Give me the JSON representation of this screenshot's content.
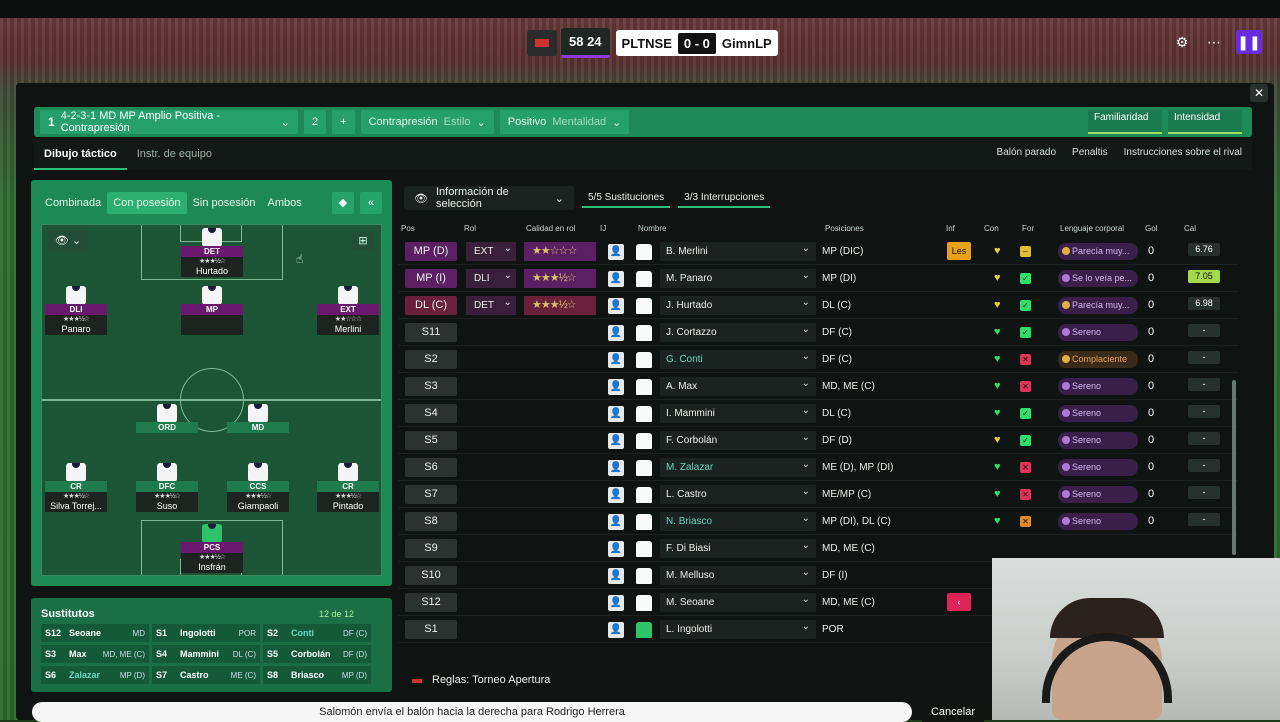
{
  "score": {
    "time": "58 24",
    "home": "PLTNSE",
    "result": "0 - 0",
    "away": "GimnLP"
  },
  "tactic": {
    "num": "1",
    "name": "4-2-3-1 MD MP Amplio Positiva - Contrapresión",
    "slot": "2",
    "add": "+",
    "style_value": "Contrapresión",
    "style_label": "Estilo",
    "mentality_value": "Positivo",
    "mentality_label": "Mentalidad",
    "familiarity": "Familiaridad",
    "intensity": "Intensidad"
  },
  "tabs": [
    "Dibujo táctico",
    "Instr. de equipo"
  ],
  "actions": [
    "Balón parado",
    "Penaltis",
    "Instrucciones sobre el rival"
  ],
  "pitch_tabs": [
    "Combinada",
    "Con posesión",
    "Sin posesión",
    "Ambos"
  ],
  "pitch_players": [
    {
      "role": "DET",
      "stars": "★★★½☆",
      "name": "Hurtado",
      "color": "purple"
    },
    {
      "role": "DLI",
      "stars": "★★★½☆",
      "name": "Panaro",
      "color": "purple"
    },
    {
      "role": "MP",
      "stars": "",
      "name": "",
      "color": "purple"
    },
    {
      "role": "EXT",
      "stars": "★★☆☆☆",
      "name": "Merlini",
      "color": "purple"
    },
    {
      "role": "ORD",
      "stars": "",
      "name": "",
      "color": "green"
    },
    {
      "role": "MD",
      "stars": "",
      "name": "",
      "color": "green"
    },
    {
      "role": "CR",
      "stars": "★★★½☆",
      "name": "Silva Torrej...",
      "color": "green"
    },
    {
      "role": "DFC",
      "stars": "★★★½☆",
      "name": "Suso",
      "color": "green"
    },
    {
      "role": "CCS",
      "stars": "★★★½☆",
      "name": "Giampaoli",
      "color": "green"
    },
    {
      "role": "CR",
      "stars": "★★★½☆",
      "name": "Pintado",
      "color": "green"
    },
    {
      "role": "PCS",
      "stars": "★★★½☆",
      "name": "Insfrán",
      "color": "green"
    }
  ],
  "subs": {
    "title": "Sustitutos",
    "count": "12 de 12",
    "items": [
      {
        "n": "S12",
        "name": "Seoane",
        "pos": "MD",
        "teal": false
      },
      {
        "n": "S1",
        "name": "Ingolotti",
        "pos": "POR",
        "teal": false
      },
      {
        "n": "S2",
        "name": "Conti",
        "pos": "DF (C)",
        "teal": true
      },
      {
        "n": "S3",
        "name": "Max",
        "pos": "MD, ME (C)",
        "teal": false
      },
      {
        "n": "S4",
        "name": "Mammini",
        "pos": "DL (C)",
        "teal": false
      },
      {
        "n": "S5",
        "name": "Corbolán",
        "pos": "DF (D)",
        "teal": false
      },
      {
        "n": "S6",
        "name": "Zalazar",
        "pos": "MP (D)",
        "teal": true
      },
      {
        "n": "S7",
        "name": "Castro",
        "pos": "ME (C)",
        "teal": false
      },
      {
        "n": "S8",
        "name": "Briasco",
        "pos": "MP (D)",
        "teal": false
      }
    ]
  },
  "table": {
    "info_btn": "Información de selección",
    "subs_count": "5/5 Sustituciones",
    "interruptions": "3/3 Interrupciones",
    "headers": [
      "Pos",
      "Rol",
      "Calidad en rol",
      "IJ",
      "Nombre",
      "Posiciones",
      "Inf",
      "Con",
      "For",
      "Lenguaje corporal",
      "Gol",
      "Cal"
    ],
    "rows": [
      {
        "pos": "MP (D)",
        "pc": "purple",
        "rol": "EXT",
        "stars": "★★☆☆☆",
        "sc": "purple",
        "name": "B. Merlini",
        "teal": false,
        "posi": "MP (DIC)",
        "inf": "Les",
        "ic": "",
        "con": "♥",
        "cc": "y",
        "for": "–",
        "fc": "y",
        "lang": "Parecía muy...",
        "lc": "yel",
        "gol": "0",
        "cal": "6.76",
        "calc": ""
      },
      {
        "pos": "MP (I)",
        "pc": "purple",
        "rol": "DLI",
        "stars": "★★★½☆",
        "sc": "purple",
        "name": "M. Panaro",
        "teal": false,
        "posi": "MP (DI)",
        "inf": "",
        "ic": "",
        "con": "♥",
        "cc": "y",
        "for": "✓",
        "fc": "g",
        "lang": "Se lo veía pe...",
        "lc": "",
        "gol": "0",
        "cal": "7.05",
        "calc": "g"
      },
      {
        "pos": "DL (C)",
        "pc": "red",
        "rol": "DET",
        "stars": "★★★½☆",
        "sc": "red",
        "name": "J. Hurtado",
        "teal": false,
        "posi": "DL (C)",
        "inf": "",
        "ic": "",
        "con": "♥",
        "cc": "y",
        "for": "✓",
        "fc": "g",
        "lang": "Parecía muy...",
        "lc": "yel",
        "gol": "0",
        "cal": "6.98",
        "calc": ""
      },
      {
        "pos": "S11",
        "pc": "",
        "rol": "",
        "stars": "",
        "sc": "",
        "name": "J. Cortazzo",
        "teal": false,
        "posi": "DF (C)",
        "inf": "",
        "ic": "",
        "con": "♥",
        "cc": "",
        "for": "✓",
        "fc": "g",
        "lang": "Sereno",
        "lc": "",
        "gol": "0",
        "cal": "-",
        "calc": ""
      },
      {
        "pos": "S2",
        "pc": "",
        "rol": "",
        "stars": "",
        "sc": "",
        "name": "G. Conti",
        "teal": true,
        "posi": "DF (C)",
        "inf": "",
        "ic": "",
        "con": "♥",
        "cc": "",
        "for": "✕",
        "fc": "r",
        "lang": "Complaciente",
        "lc": "orange",
        "gol": "0",
        "cal": "-",
        "calc": ""
      },
      {
        "pos": "S3",
        "pc": "",
        "rol": "",
        "stars": "",
        "sc": "",
        "name": "A. Max",
        "teal": false,
        "posi": "MD, ME (C)",
        "inf": "",
        "ic": "",
        "con": "♥",
        "cc": "",
        "for": "✕",
        "fc": "r",
        "lang": "Sereno",
        "lc": "",
        "gol": "0",
        "cal": "-",
        "calc": ""
      },
      {
        "pos": "S4",
        "pc": "",
        "rol": "",
        "stars": "",
        "sc": "",
        "name": "I. Mammini",
        "teal": false,
        "posi": "DL (C)",
        "inf": "",
        "ic": "",
        "con": "♥",
        "cc": "",
        "for": "✓",
        "fc": "g",
        "lang": "Sereno",
        "lc": "",
        "gol": "0",
        "cal": "-",
        "calc": ""
      },
      {
        "pos": "S5",
        "pc": "",
        "rol": "",
        "stars": "",
        "sc": "",
        "name": "F. Corbolán",
        "teal": false,
        "posi": "DF (D)",
        "inf": "",
        "ic": "",
        "con": "♥",
        "cc": "y",
        "for": "✓",
        "fc": "g",
        "lang": "Sereno",
        "lc": "",
        "gol": "0",
        "cal": "-",
        "calc": ""
      },
      {
        "pos": "S6",
        "pc": "",
        "rol": "",
        "stars": "",
        "sc": "",
        "name": "M. Zalazar",
        "teal": true,
        "posi": "ME (D), MP (DI)",
        "inf": "",
        "ic": "",
        "con": "♥",
        "cc": "",
        "for": "✕",
        "fc": "r",
        "lang": "Sereno",
        "lc": "",
        "gol": "0",
        "cal": "-",
        "calc": ""
      },
      {
        "pos": "S7",
        "pc": "",
        "rol": "",
        "stars": "",
        "sc": "",
        "name": "L. Castro",
        "teal": false,
        "posi": "ME/MP (C)",
        "inf": "",
        "ic": "",
        "con": "♥",
        "cc": "",
        "for": "✕",
        "fc": "r",
        "lang": "Sereno",
        "lc": "",
        "gol": "0",
        "cal": "-",
        "calc": ""
      },
      {
        "pos": "S8",
        "pc": "",
        "rol": "",
        "stars": "",
        "sc": "",
        "name": "N. Briasco",
        "teal": true,
        "posi": "MP (DI), DL (C)",
        "inf": "",
        "ic": "",
        "con": "♥",
        "cc": "",
        "for": "✕",
        "fc": "o",
        "lang": "Sereno",
        "lc": "",
        "gol": "0",
        "cal": "-",
        "calc": ""
      },
      {
        "pos": "S9",
        "pc": "",
        "rol": "",
        "stars": "",
        "sc": "",
        "name": "F. Di Biasi",
        "teal": false,
        "posi": "MD, ME (C)",
        "inf": "",
        "ic": "",
        "con": "",
        "cc": "",
        "for": "",
        "fc": "",
        "lang": "",
        "lc": "",
        "gol": "",
        "cal": "",
        "calc": ""
      },
      {
        "pos": "S10",
        "pc": "",
        "rol": "",
        "stars": "",
        "sc": "",
        "name": "M. Melluso",
        "teal": false,
        "posi": "DF (I)",
        "inf": "",
        "ic": "",
        "con": "",
        "cc": "",
        "for": "",
        "fc": "",
        "lang": "",
        "lc": "",
        "gol": "",
        "cal": "",
        "calc": ""
      },
      {
        "pos": "S12",
        "pc": "",
        "rol": "",
        "stars": "",
        "sc": "",
        "name": "M. Seoane",
        "teal": false,
        "posi": "MD, ME (C)",
        "inf": "‹",
        "ic": "pink",
        "con": "",
        "cc": "",
        "for": "",
        "fc": "",
        "lang": "",
        "lc": "",
        "gol": "",
        "cal": "",
        "calc": ""
      },
      {
        "pos": "S1",
        "pc": "",
        "rol": "",
        "stars": "",
        "sc": "",
        "name": "L. Ingolotti",
        "teal": false,
        "posi": "POR",
        "inf": "",
        "ic": "",
        "con": "",
        "cc": "",
        "for": "",
        "fc": "",
        "lang": "",
        "lc": "",
        "gol": "",
        "cal": "",
        "calc": "",
        "gk": true
      }
    ]
  },
  "rules": "Reglas: Torneo Apertura",
  "commentary": "Salomón envía el balón hacia la derecha para Rodrigo Herrera",
  "cancel": "Cancelar"
}
